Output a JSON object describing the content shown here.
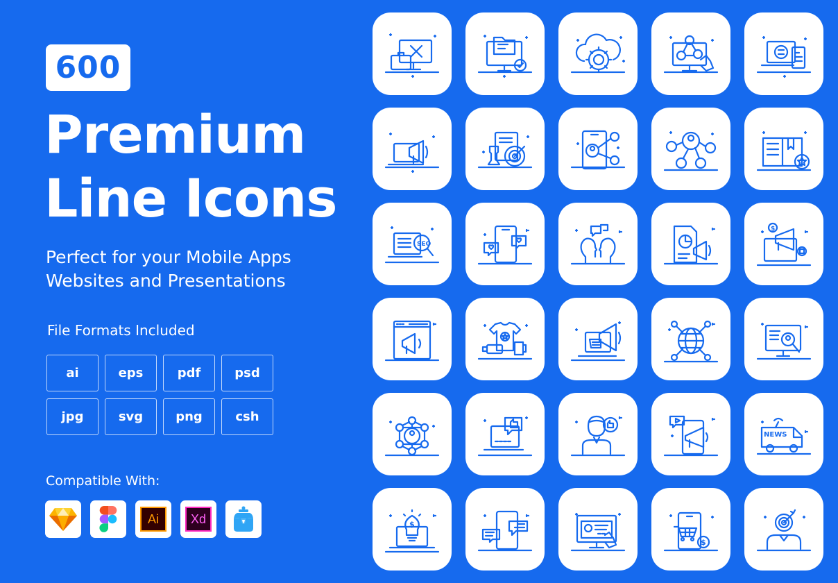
{
  "colors": {
    "background": "#166aee",
    "tile": "#ffffff",
    "icon_stroke": "#166aee"
  },
  "hero": {
    "badge": "600",
    "title_line1": "Premium",
    "title_line2": "Line Icons",
    "subtitle_line1": "Perfect for your Mobile Apps",
    "subtitle_line2": "Websites and Presentations"
  },
  "formats": {
    "label": "File Formats Included",
    "items": [
      "ai",
      "eps",
      "pdf",
      "psd",
      "jpg",
      "svg",
      "png",
      "csh"
    ]
  },
  "compatible": {
    "label": "Compatible With:",
    "apps": [
      {
        "name": "Sketch",
        "icon": "sketch-icon"
      },
      {
        "name": "Figma",
        "icon": "figma-icon"
      },
      {
        "name": "Adobe Illustrator",
        "icon": "illustrator-icon",
        "text": "Ai"
      },
      {
        "name": "Adobe XD",
        "icon": "xd-icon",
        "text": "Xd"
      },
      {
        "name": "Iconjar",
        "icon": "iconjar-icon"
      }
    ]
  },
  "icons": [
    "monitor-tools-briefcase",
    "monitor-folder-check",
    "cloud-gear",
    "monitor-network-hand",
    "laptop-phone-sync",
    "laptop-megaphone",
    "chess-target-strategy",
    "phone-contacts",
    "user-network",
    "book-star",
    "laptop-seo-search",
    "phone-heart-chat",
    "people-conversation",
    "document-chart-megaphone",
    "monitor-megaphone-money",
    "browser-megaphone",
    "tshirt-usb-mug",
    "laptop-hand-megaphone",
    "globe-network",
    "monitor-user-search",
    "user-hexagon-network",
    "laptop-like-rating",
    "man-thumbs-up",
    "phone-video-megaphone",
    "news-van",
    "laptop-bulb-money",
    "phone-reviews",
    "monitor-profile-click",
    "phone-cart-money",
    "person-target"
  ]
}
